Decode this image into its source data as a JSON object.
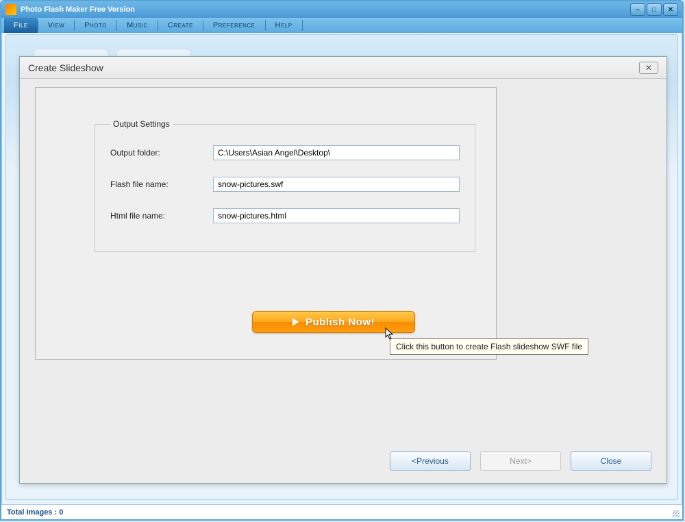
{
  "app": {
    "title": "Photo Flash Maker Free Version"
  },
  "menu": {
    "file": "File",
    "view": "View",
    "photo": "Photo",
    "music": "Music",
    "create": "Create",
    "preference": "Preference",
    "help": "Help"
  },
  "dialog": {
    "title": "Create Slideshow",
    "settings_legend": "Output Settings",
    "labels": {
      "output_folder": "Output folder:",
      "flash_file": "Flash file name:",
      "html_file": "Html file name:"
    },
    "values": {
      "output_folder": "C:\\Users\\Asian Angel\\Desktop\\",
      "flash_file": "snow-pictures.swf",
      "html_file": "snow-pictures.html"
    },
    "publish_label": "Publish Now!",
    "tooltip": "Click this button to create Flash slideshow SWF file",
    "buttons": {
      "previous": "<Previous",
      "next": "Next>",
      "close": "Close"
    }
  },
  "statusbar": {
    "text": "Total Images : 0"
  }
}
